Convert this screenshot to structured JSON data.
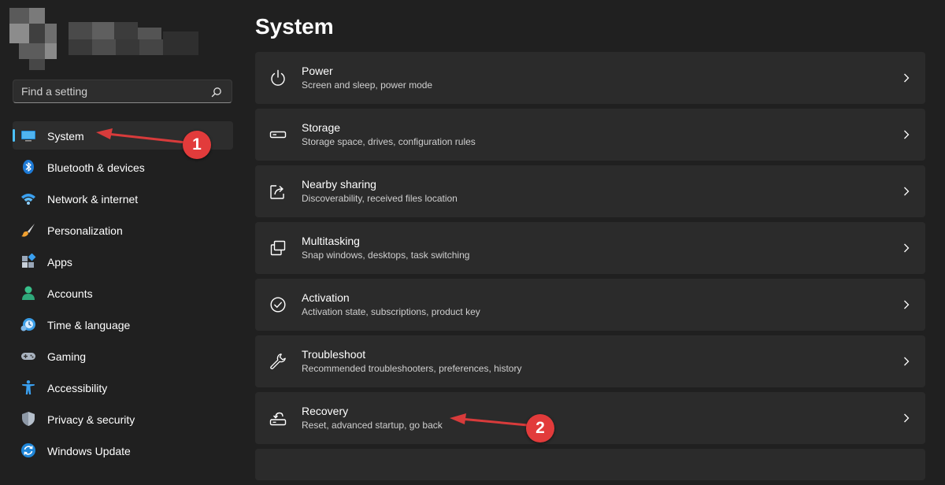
{
  "search": {
    "placeholder": "Find a setting",
    "icon": "search-icon"
  },
  "sidebar": {
    "items": [
      {
        "label": "System",
        "icon": "monitor-icon",
        "active": true
      },
      {
        "label": "Bluetooth & devices",
        "icon": "bluetooth-icon"
      },
      {
        "label": "Network & internet",
        "icon": "wifi-icon"
      },
      {
        "label": "Personalization",
        "icon": "brush-icon"
      },
      {
        "label": "Apps",
        "icon": "apps-icon"
      },
      {
        "label": "Accounts",
        "icon": "person-icon"
      },
      {
        "label": "Time & language",
        "icon": "clock-globe-icon"
      },
      {
        "label": "Gaming",
        "icon": "gamepad-icon"
      },
      {
        "label": "Accessibility",
        "icon": "accessibility-icon"
      },
      {
        "label": "Privacy & security",
        "icon": "shield-icon"
      },
      {
        "label": "Windows Update",
        "icon": "update-icon"
      }
    ]
  },
  "main": {
    "title": "System",
    "cards": [
      {
        "title": "Power",
        "subtitle": "Screen and sleep, power mode",
        "icon": "power-icon"
      },
      {
        "title": "Storage",
        "subtitle": "Storage space, drives, configuration rules",
        "icon": "storage-icon"
      },
      {
        "title": "Nearby sharing",
        "subtitle": "Discoverability, received files location",
        "icon": "share-icon"
      },
      {
        "title": "Multitasking",
        "subtitle": "Snap windows, desktops, task switching",
        "icon": "multitasking-icon"
      },
      {
        "title": "Activation",
        "subtitle": "Activation state, subscriptions, product key",
        "icon": "checkmark-circle-icon"
      },
      {
        "title": "Troubleshoot",
        "subtitle": "Recommended troubleshooters, preferences, history",
        "icon": "wrench-icon"
      },
      {
        "title": "Recovery",
        "subtitle": "Reset, advanced startup, go back",
        "icon": "recovery-icon"
      }
    ]
  },
  "annotations": {
    "badge1": "1",
    "badge2": "2"
  },
  "colors": {
    "accent": "#4cc2ff",
    "annotation": "#e23b3b",
    "background": "#202020",
    "card": "#2b2b2b"
  }
}
